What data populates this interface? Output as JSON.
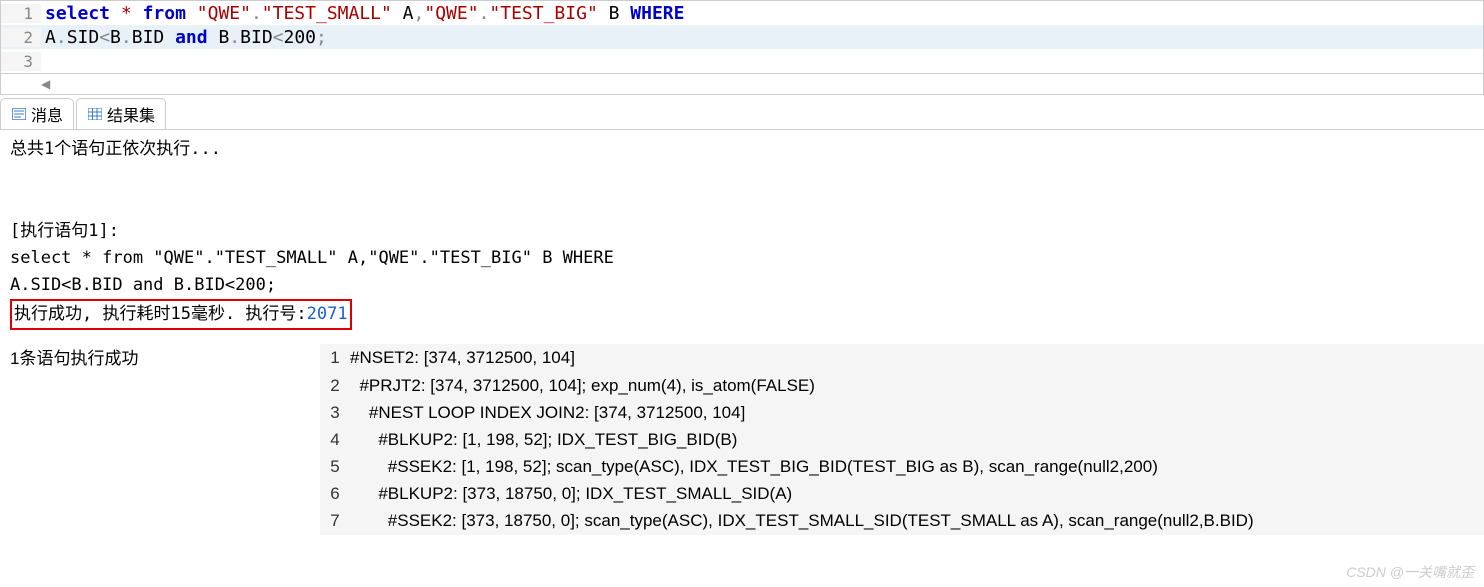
{
  "editor": {
    "line1": {
      "num": "1",
      "parts": [
        {
          "cls": "kw-blue",
          "t": "select"
        },
        {
          "cls": "",
          "t": " "
        },
        {
          "cls": "kw-red",
          "t": "*"
        },
        {
          "cls": "",
          "t": " "
        },
        {
          "cls": "kw-blue",
          "t": "from"
        },
        {
          "cls": "",
          "t": " "
        },
        {
          "cls": "kw-red",
          "t": "\"QWE\""
        },
        {
          "cls": "kw-gray",
          "t": "."
        },
        {
          "cls": "kw-red",
          "t": "\"TEST_SMALL\""
        },
        {
          "cls": "",
          "t": " A"
        },
        {
          "cls": "kw-gray",
          "t": ","
        },
        {
          "cls": "kw-red",
          "t": "\"QWE\""
        },
        {
          "cls": "kw-gray",
          "t": "."
        },
        {
          "cls": "kw-red",
          "t": "\"TEST_BIG\""
        },
        {
          "cls": "",
          "t": " B "
        },
        {
          "cls": "kw-blue",
          "t": "WHERE"
        }
      ]
    },
    "line2": {
      "num": "2",
      "parts": [
        {
          "cls": "",
          "t": "A"
        },
        {
          "cls": "kw-gray",
          "t": "."
        },
        {
          "cls": "",
          "t": "SID"
        },
        {
          "cls": "kw-gray",
          "t": "<"
        },
        {
          "cls": "",
          "t": "B"
        },
        {
          "cls": "kw-gray",
          "t": "."
        },
        {
          "cls": "",
          "t": "BID "
        },
        {
          "cls": "kw-blue",
          "t": "and"
        },
        {
          "cls": "",
          "t": " B"
        },
        {
          "cls": "kw-gray",
          "t": "."
        },
        {
          "cls": "",
          "t": "BID"
        },
        {
          "cls": "kw-gray",
          "t": "<"
        },
        {
          "cls": "",
          "t": "200"
        },
        {
          "cls": "kw-gray",
          "t": ";"
        }
      ]
    },
    "line3": {
      "num": "3"
    }
  },
  "tabs": {
    "messages": "消息",
    "results": "结果集"
  },
  "output": {
    "running": "总共1个语句正依次执行...",
    "exec_label": "[执行语句1]:",
    "sql1": "select * from \"QWE\".\"TEST_SMALL\" A,\"QWE\".\"TEST_BIG\" B WHERE",
    "sql2": "A.SID<B.BID and B.BID<200;",
    "success_prefix": "执行成功, 执行耗时15毫秒. 执行号:",
    "exec_id": "2071",
    "done": "1条语句执行成功"
  },
  "plan": {
    "rows": [
      {
        "n": "1",
        "t": "#NSET2: [374, 3712500, 104]"
      },
      {
        "n": "2",
        "t": "  #PRJT2: [374, 3712500, 104]; exp_num(4), is_atom(FALSE)"
      },
      {
        "n": "3",
        "t": "    #NEST LOOP INDEX JOIN2: [374, 3712500, 104]"
      },
      {
        "n": "4",
        "t": "      #BLKUP2: [1, 198, 52]; IDX_TEST_BIG_BID(B)"
      },
      {
        "n": "5",
        "t": "        #SSEK2: [1, 198, 52]; scan_type(ASC), IDX_TEST_BIG_BID(TEST_BIG as B), scan_range(null2,200)"
      },
      {
        "n": "6",
        "t": "      #BLKUP2: [373, 18750, 0]; IDX_TEST_SMALL_SID(A)"
      },
      {
        "n": "7",
        "t": "        #SSEK2: [373, 18750, 0]; scan_type(ASC), IDX_TEST_SMALL_SID(TEST_SMALL as A), scan_range(null2,B.BID)"
      }
    ]
  },
  "watermark": "CSDN @一关嘴就歪"
}
